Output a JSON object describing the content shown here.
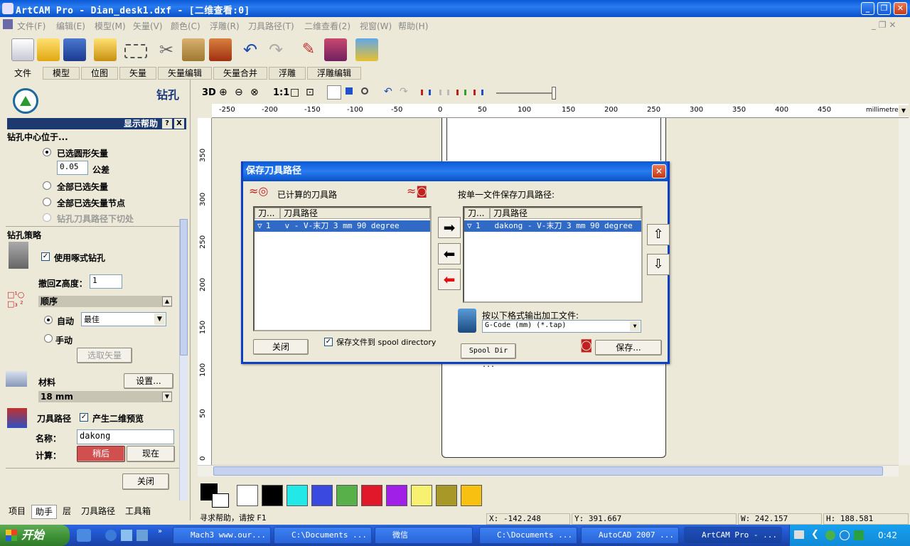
{
  "window": {
    "title": "ArtCAM Pro - Dian_desk1.dxf - [二维查看:0]"
  },
  "menu": {
    "items": [
      "文件(F)",
      "编辑(E)",
      "模型(M)",
      "矢量(V)",
      "颜色(C)",
      "浮雕(R)",
      "刀具路径(T)",
      "二维查看(2)",
      "视窗(W)",
      "帮助(H)"
    ]
  },
  "toolbar_tabs": [
    "文件",
    "模型",
    "位图",
    "矢量",
    "矢量编辑",
    "矢量合并",
    "浮雕",
    "浮雕编辑"
  ],
  "left_panel": {
    "heading": "钻孔",
    "help_bar": "显示帮助",
    "help_q": "?",
    "help_x": "X",
    "center_label": "钻孔中心位于...",
    "options": [
      {
        "label": "已选圆形矢量",
        "selected": true
      },
      {
        "label": "全部已选矢量",
        "selected": false
      },
      {
        "label": "全部已选矢量节点",
        "selected": false
      },
      {
        "label": "钻孔刀具路径下切处",
        "selected": false,
        "disabled": true
      }
    ],
    "tolerance_value": "0.05",
    "tolerance_label": "公差",
    "strategy_label": "钻孔策略",
    "peck_label": "使用啄式钻孔",
    "retract_label": "撤回Z高度：",
    "retract_value": "1",
    "order_label": "顺序",
    "auto_label": "自动",
    "auto_value": "最佳",
    "manual_label": "手动",
    "select_vectors_btn": "选取矢量",
    "material_label": "材料",
    "settings_btn": "设置...",
    "material_value": "18 mm",
    "toolpath_label": "刀具路径",
    "preview_label": "产生二维预览",
    "name_label": "名称：",
    "name_value": "dakong",
    "compute_label": "计算：",
    "later_btn": "稍后",
    "now_btn": "现在",
    "close_btn": "关闭"
  },
  "bottom_tabs": [
    "项目",
    "助手",
    "层",
    "刀具路径",
    "工具箱"
  ],
  "ruler": {
    "h_ticks": [
      "-250",
      "-200",
      "-150",
      "-100",
      "-50",
      "0",
      "50",
      "100",
      "150",
      "200",
      "250",
      "300",
      "350",
      "400",
      "450"
    ],
    "units": "millimetres",
    "v_ticks": [
      "350",
      "300",
      "250",
      "200",
      "150",
      "100",
      "50",
      "0"
    ]
  },
  "view_toolbar": {
    "label_3d": "3D",
    "label_11": "1:1"
  },
  "dialog": {
    "title": "保存刀具路径",
    "computed_label": "已计算的刀具路",
    "single_file_label": "按单一文件保存刀具路径:",
    "left_list": {
      "col1": "刀...",
      "col2": "刀具路径",
      "rows": [
        {
          "num": "1",
          "text": "v - V-末刀 3 mm 90 degree"
        }
      ]
    },
    "right_list": {
      "col1": "刀...",
      "col2": "刀具路径",
      "rows": [
        {
          "num": "1",
          "text": "dakong - V-末刀 3 mm 90 degree"
        }
      ]
    },
    "format_label": "按以下格式输出加工文件:",
    "format_value": "G-Code (mm) (*.tap)",
    "close_btn": "关闭",
    "spool_check_label": "保存文件到 spool directory",
    "spool_dir_btn": "Spool Dir ...",
    "save_btn": "保存..."
  },
  "palette_colors": [
    "#ffffff",
    "#000000",
    "#22e8e8",
    "#3a4ae0",
    "#58b04a",
    "#e0182a",
    "#a020e8",
    "#f8f070",
    "#a89828",
    "#f8c010"
  ],
  "status": {
    "help": "寻求帮助，请按 F1",
    "x": "X: -142.248",
    "y": "Y: 391.667",
    "w": "W: 242.157",
    "h": "H: 188.581"
  },
  "taskbar": {
    "start": "开始",
    "items": [
      "Mach3 www.our...",
      "C:\\Documents ...",
      "微信",
      "C:\\Documents ...",
      "AutoCAD 2007 ...",
      "ArtCAM Pro - ..."
    ],
    "clock": "0:42"
  }
}
